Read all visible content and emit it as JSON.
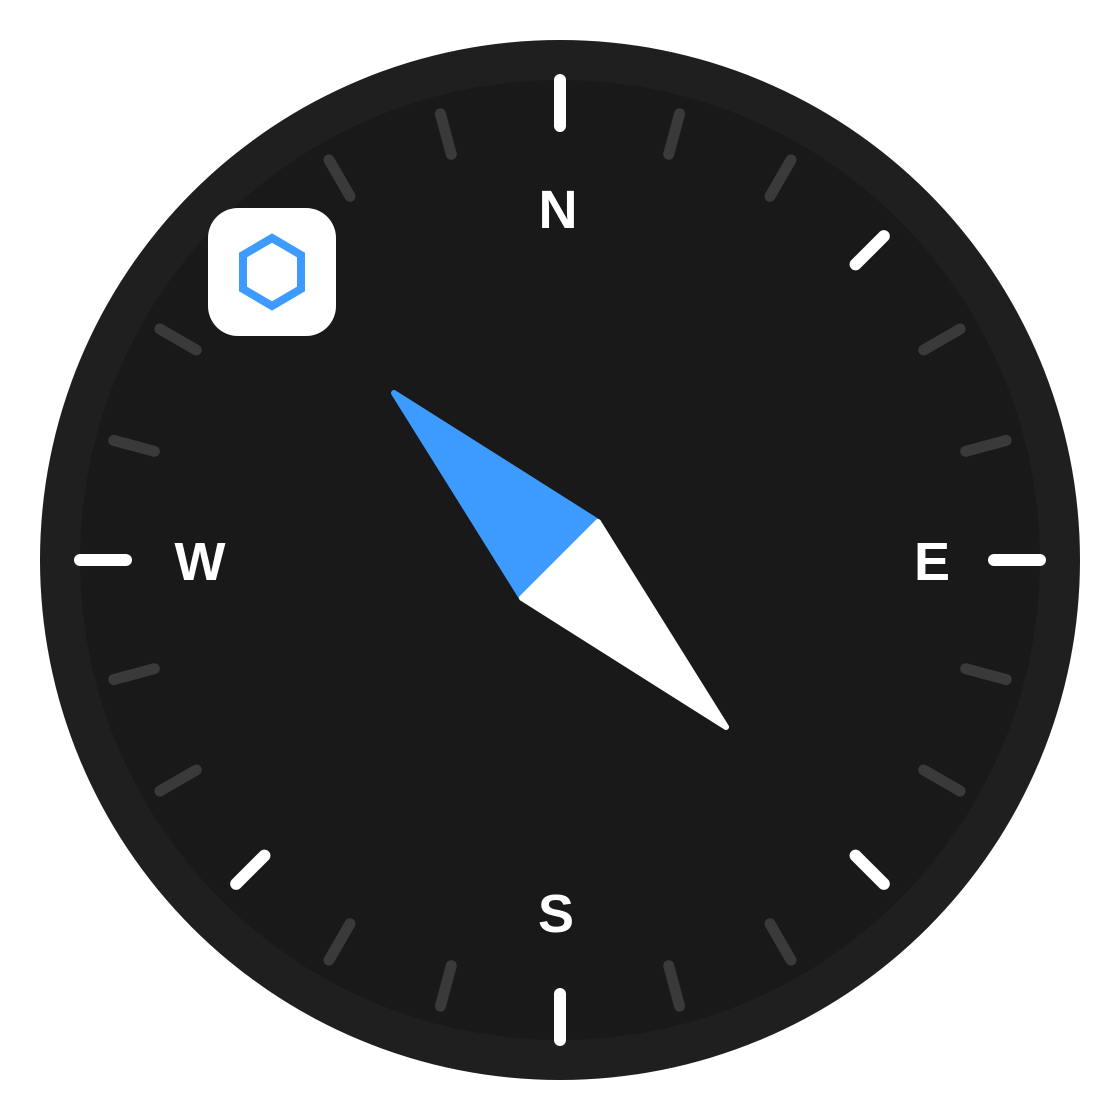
{
  "compass": {
    "cardinals": {
      "north": "N",
      "east": "E",
      "south": "S",
      "west": "W"
    },
    "heading_degrees": 315,
    "tick_interval_degrees": 15,
    "colors": {
      "bezel": "#1f1f1f",
      "face": "#191919",
      "major_tick": "#ffffff",
      "minor_tick": "#3a3a3a",
      "needle_primary": "#3d9bff",
      "needle_secondary": "#ffffff"
    }
  },
  "app_badge": {
    "icon": "hexagon-icon",
    "icon_color": "#3d9bff",
    "background": "#ffffff"
  }
}
